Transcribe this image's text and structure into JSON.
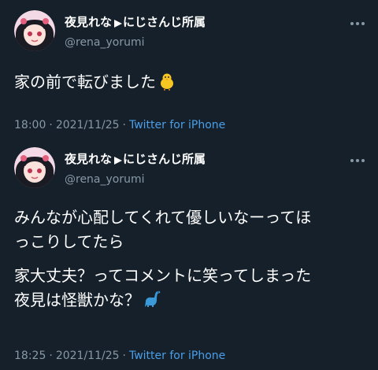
{
  "tweets": [
    {
      "display_name": "夜見れな",
      "name_badge": "にじさんじ所属",
      "handle": "@rena_yorumi",
      "lines": [
        "家の前で転びました"
      ],
      "trailing_icon": "chick-emoji",
      "time": "18:00",
      "date": "2021/11/25",
      "source": "Twitter for iPhone"
    },
    {
      "display_name": "夜見れな",
      "name_badge": "にじさんじ所属",
      "handle": "@rena_yorumi",
      "lines": [
        "みんなが心配してくれて優しいなーってほ",
        "っこりしてたら",
        "家大丈夫？ってコメントに笑ってしまった",
        "夜見は怪獣かな？"
      ],
      "trailing_icon": "dinosaur-emoji",
      "time": "18:25",
      "date": "2021/11/25",
      "source": "Twitter for iPhone"
    }
  ],
  "separator": "·",
  "colors": {
    "background": "#15202b",
    "text": "#ffffff",
    "secondary": "#8899a6",
    "link": "#4a9fe8"
  }
}
